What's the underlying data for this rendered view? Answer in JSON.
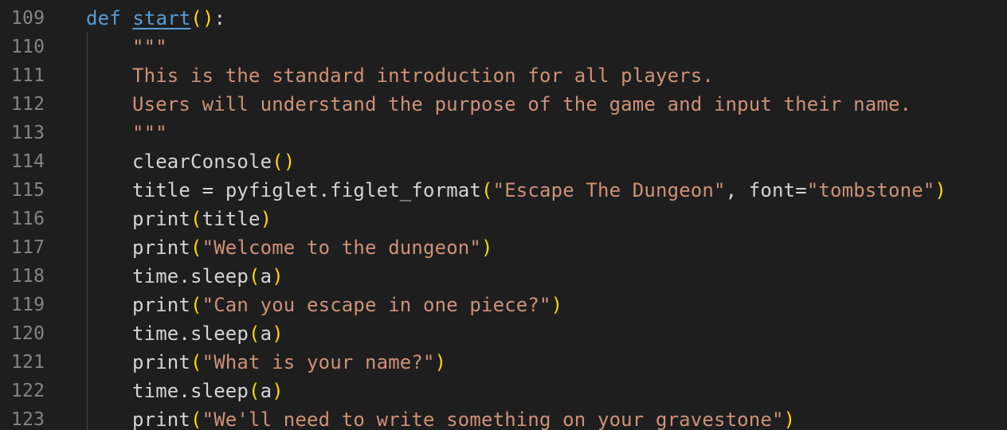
{
  "editor": {
    "lines": [
      {
        "number": "109",
        "tokens": {
          "kw": "def",
          "name": "start",
          "open": "(",
          "close": ")",
          "colon": ":"
        }
      },
      {
        "number": "110",
        "text": "\"\"\""
      },
      {
        "number": "111",
        "text": "This is the standard introduction for all players."
      },
      {
        "number": "112",
        "text": "Users will understand the purpose of the game and input their name."
      },
      {
        "number": "113",
        "text": "\"\"\""
      },
      {
        "number": "114",
        "fn": "clearConsole",
        "open": "(",
        "close": ")"
      },
      {
        "number": "115",
        "lhs": "title",
        "eq": " = ",
        "call": "pyfiglet.figlet_format",
        "open": "(",
        "arg1": "\"Escape The Dungeon\"",
        "sep": ", ",
        "kwname": "font",
        "kweq": "=",
        "kwval": "\"tombstone\"",
        "close": ")"
      },
      {
        "number": "116",
        "fn": "print",
        "open": "(",
        "arg": "title",
        "close": ")"
      },
      {
        "number": "117",
        "fn": "print",
        "open": "(",
        "str": "\"Welcome to the dungeon\"",
        "close": ")"
      },
      {
        "number": "118",
        "fn": "time.sleep",
        "open": "(",
        "arg": "a",
        "close": ")"
      },
      {
        "number": "119",
        "fn": "print",
        "open": "(",
        "str": "\"Can you escape in one piece?\"",
        "close": ")"
      },
      {
        "number": "120",
        "fn": "time.sleep",
        "open": "(",
        "arg": "a",
        "close": ")"
      },
      {
        "number": "121",
        "fn": "print",
        "open": "(",
        "str": "\"What is your name?\"",
        "close": ")"
      },
      {
        "number": "122",
        "fn": "time.sleep",
        "open": "(",
        "arg": "a",
        "close": ")"
      },
      {
        "number": "123",
        "fn": "print",
        "open": "(",
        "str": "\"We'll need to write something on your gravestone\"",
        "close": ")"
      }
    ]
  },
  "colors": {
    "background": "#1e1e1e",
    "line_number": "#858585",
    "keyword": "#569cd6",
    "string": "#ce9178",
    "bracket": "#ffd700",
    "identifier": "#d4d4d4"
  }
}
